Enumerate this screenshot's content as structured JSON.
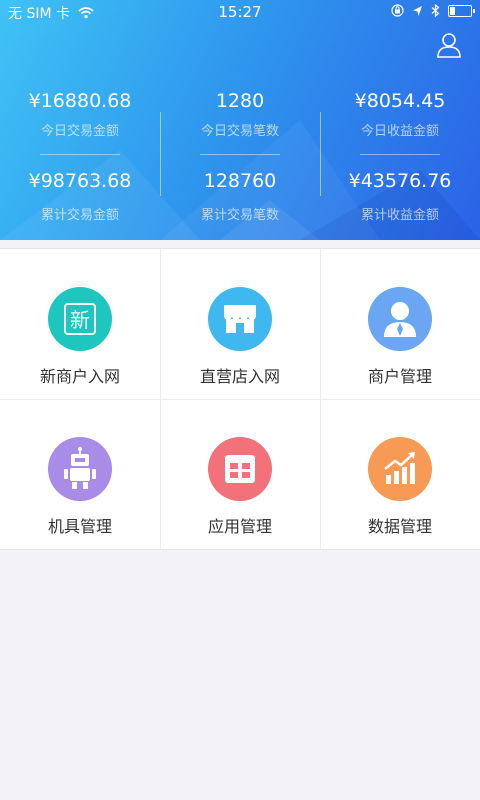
{
  "status_bar": {
    "carrier": "无 SIM 卡",
    "wifi_icon": "wifi-icon",
    "time": "15:27",
    "icons": [
      "orientation-lock-icon",
      "location-arrow-icon",
      "bluetooth-icon",
      "battery-icon"
    ],
    "battery_level": 0.2
  },
  "header": {
    "user_icon": "user-icon",
    "stats": [
      {
        "top_value": "¥16880.68",
        "top_label": "今日交易金额",
        "bottom_value": "¥98763.68",
        "bottom_label": "累计交易金额"
      },
      {
        "top_value": "1280",
        "top_label": "今日交易笔数",
        "bottom_value": "128760",
        "bottom_label": "累计交易笔数"
      },
      {
        "top_value": "¥8054.45",
        "top_label": "今日收益金额",
        "bottom_value": "¥43576.76",
        "bottom_label": "累计收益金额"
      }
    ],
    "gradient_colors": [
      "#3fc3f5",
      "#2f97ee",
      "#2b62e6"
    ]
  },
  "menu": [
    {
      "label": "新商户入网",
      "icon": "new-merchant-icon",
      "icon_text": "新",
      "color": "#1fc6c0"
    },
    {
      "label": "直营店入网",
      "icon": "store-icon",
      "color": "#3fb8f0"
    },
    {
      "label": "商户管理",
      "icon": "merchant-person-icon",
      "color": "#6aa6f2"
    },
    {
      "label": "机具管理",
      "icon": "robot-icon",
      "color": "#a98be8"
    },
    {
      "label": "应用管理",
      "icon": "app-grid-icon",
      "color": "#f2717a"
    },
    {
      "label": "数据管理",
      "icon": "chart-trend-icon",
      "color": "#f79a56"
    }
  ]
}
